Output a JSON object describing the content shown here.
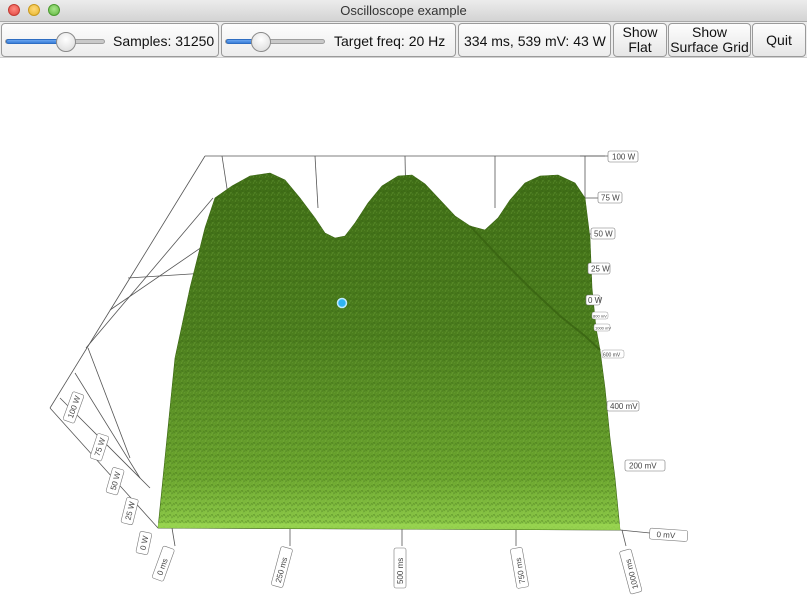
{
  "window": {
    "title": "Oscilloscope example"
  },
  "toolbar": {
    "samples_label": "Samples: 31250",
    "samples_slider_level": 0.6,
    "freq_label": "Target freq: 20 Hz",
    "freq_slider_level": 0.35,
    "readout": "334 ms, 539 mV: 43 W",
    "show_flat": [
      "Show",
      "Flat"
    ],
    "show_surface_grid": [
      "Show",
      "Surface Grid"
    ],
    "quit": "Quit"
  },
  "graph": {
    "surface_color": "#4e7f1f",
    "surface_highlight": "#8fc94b",
    "selection_color": "#2fb4f2",
    "time_axis_labels": [
      "0 ms",
      "250 ms",
      "500 ms",
      "750 ms",
      "1000 ms"
    ],
    "voltage_axis_labels": [
      "0 mV",
      "200 mV",
      "400 mV",
      "600 mV",
      "800 mV",
      "1000 mV"
    ],
    "power_axis_labels": [
      "100 W",
      "75 W",
      "50 W",
      "25 W",
      "0 W"
    ],
    "power_axis_left_labels": [
      "100 W",
      "75 W",
      "50 W",
      "25 W",
      "0 W"
    ]
  }
}
